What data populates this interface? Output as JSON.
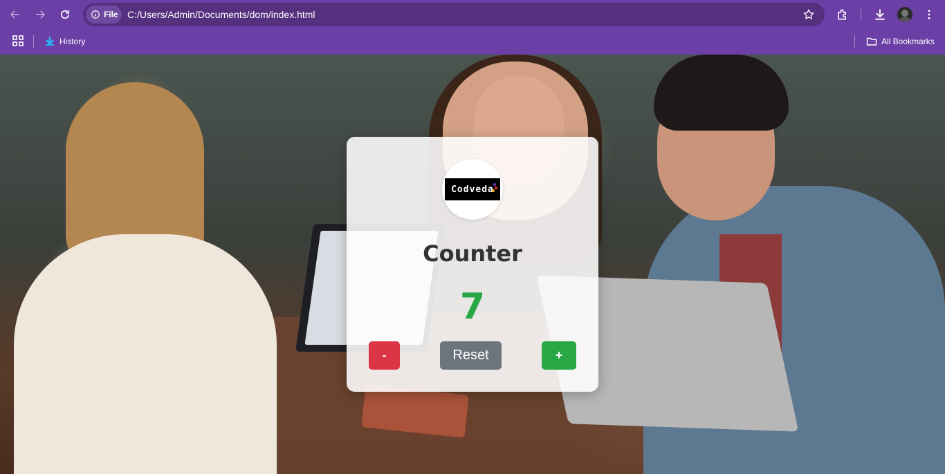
{
  "browser": {
    "address_chip_label": "File",
    "url": "C:/Users/Admin/Documents/dom/index.html",
    "bookmarks": {
      "history_label": "History",
      "all_bookmarks_label": "All Bookmarks"
    }
  },
  "card": {
    "logo_text": "Codveda",
    "title": "Counter",
    "count": "7",
    "decrement_label": "-",
    "reset_label": "Reset",
    "increment_label": "+"
  },
  "colors": {
    "chrome": "#6b3fa6",
    "count": "#28a745",
    "decrement": "#dc3545",
    "reset": "#6c757d",
    "increment": "#28a745"
  }
}
